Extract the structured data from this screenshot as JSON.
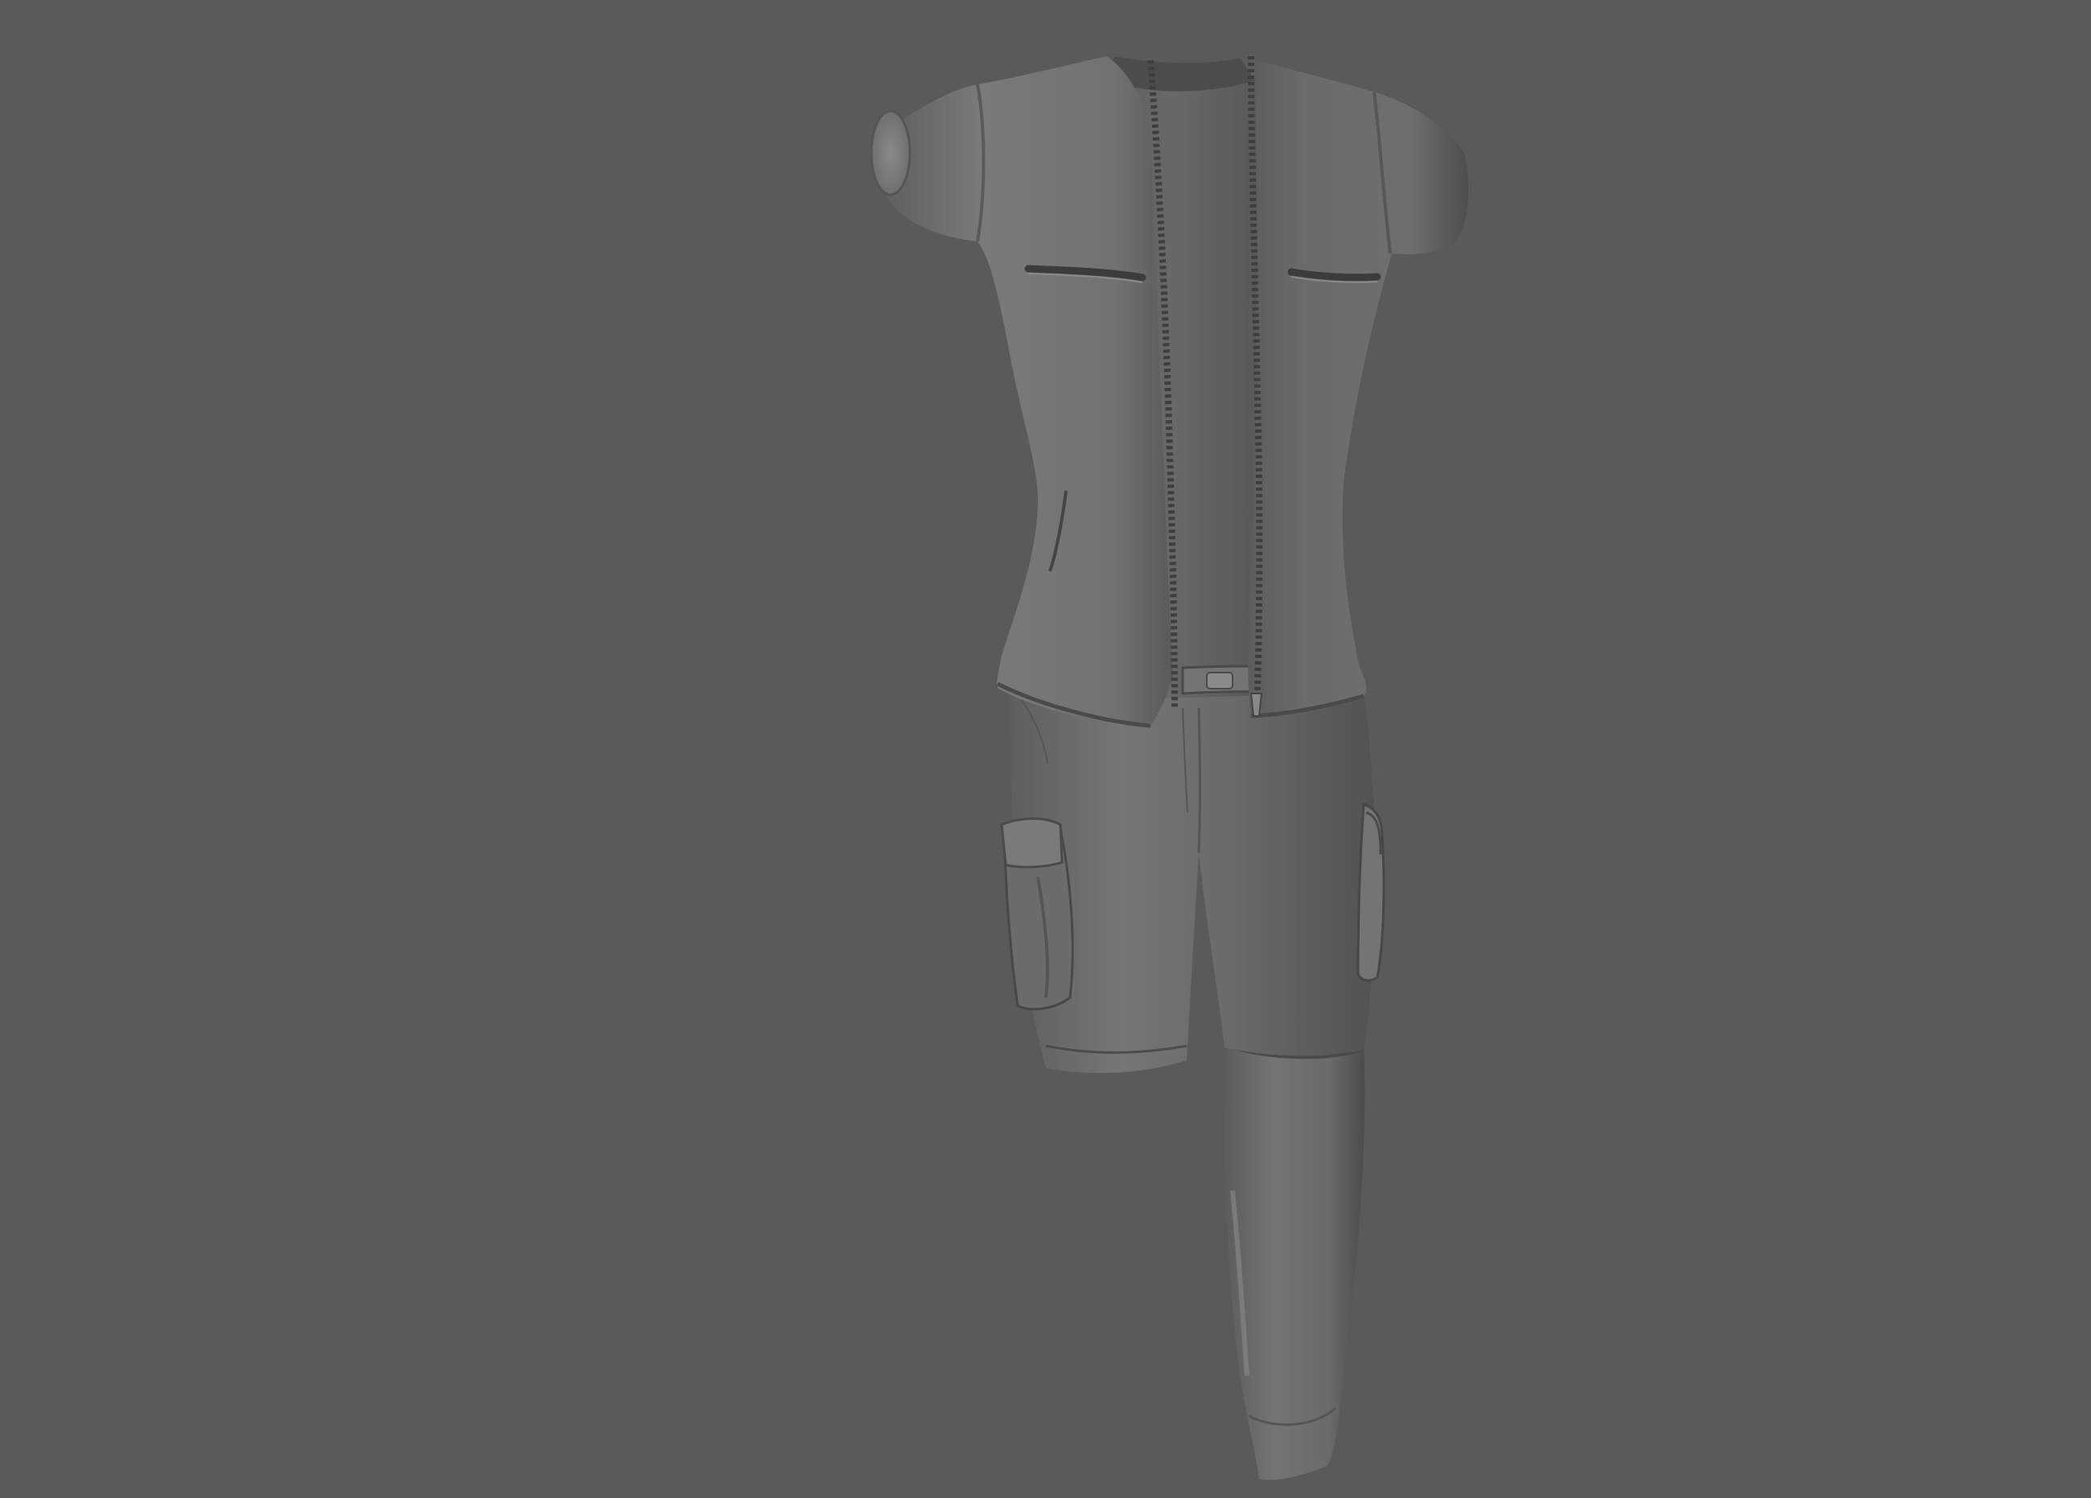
{
  "viewport": {
    "background_color": "#5a5a5a",
    "model": {
      "kind": "3D garment mesh (shaded, untextured)",
      "base_color": "#6e6e6e",
      "shadow_color": "#3c3c3c",
      "highlight_color": "#8a8a8a",
      "parts": [
        "jacket",
        "undershirt",
        "zipper",
        "chest-pockets",
        "belt",
        "shorts",
        "cargo-pockets",
        "pant-leg-extension"
      ]
    }
  }
}
